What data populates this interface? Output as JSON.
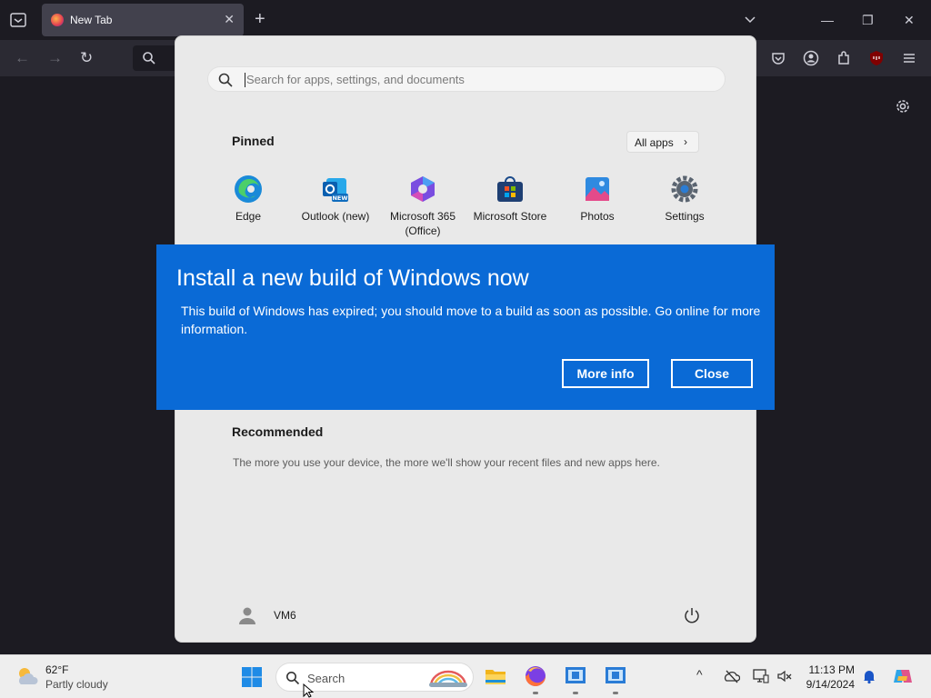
{
  "browser": {
    "tab_title": "New Tab",
    "tab_close_glyph": "✕",
    "new_tab_glyph": "+",
    "window_controls": {
      "minimize": "—",
      "restore": "❐",
      "close": "✕"
    },
    "nav": {
      "back": "←",
      "forward": "→",
      "reload": "↻"
    }
  },
  "start_menu": {
    "search_placeholder": "Search for apps, settings, and documents",
    "pinned_heading": "Pinned",
    "all_apps_label": "All apps",
    "all_apps_chevron": "›",
    "pinned_apps": [
      {
        "label": "Edge",
        "icon": "edge-icon"
      },
      {
        "label": "Outlook (new)",
        "icon": "outlook-icon"
      },
      {
        "label": "Microsoft 365 (Office)",
        "icon": "microsoft-365-icon"
      },
      {
        "label": "Microsoft Store",
        "icon": "store-icon"
      },
      {
        "label": "Photos",
        "icon": "photos-icon"
      },
      {
        "label": "Settings",
        "icon": "settings-icon"
      }
    ],
    "recommended_heading": "Recommended",
    "recommended_text": "The more you use your device, the more we'll show your recent files and new apps here.",
    "user_name": "VM6"
  },
  "dialog": {
    "title": "Install a new build of Windows now",
    "message": "This build of Windows has expired; you should move to a build as soon as possible. Go online for more information.",
    "more_info_label": "More info",
    "close_label": "Close",
    "background_color": "#0a6ad6"
  },
  "taskbar": {
    "weather_temp": "62°F",
    "weather_desc": "Partly cloudy",
    "search_label": "Search",
    "tray_chevron": "^",
    "clock_time": "11:13 PM",
    "clock_date": "9/14/2024"
  }
}
